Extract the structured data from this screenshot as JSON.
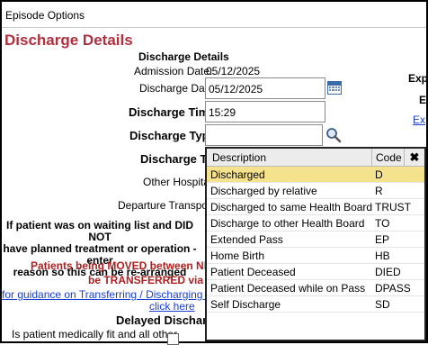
{
  "window": {
    "title": "Episode Options"
  },
  "page": {
    "title": "Discharge Details"
  },
  "form": {
    "section_title": "Discharge Details",
    "admission_label": "Admission Date:",
    "admission_value": "05/12/2025",
    "discharge_date_label": "Discharge Date",
    "discharge_date_value": "05/12/2025",
    "discharge_time_label": "Discharge Time",
    "discharge_time_value": "15:29",
    "discharge_type_label": "Discharge Type",
    "discharge_type_value": "",
    "discharge_to_label": "Discharge To",
    "other_hospital_label": "Other Hospital",
    "departure_transport_label": "Departure Transport",
    "waiting_list_line1": "If patient was on waiting list and DID NOT",
    "waiting_list_line2": "have planned treatment or operation - enter",
    "waiting_list_line3": "reason so this can be re-arranged",
    "moved_warning_line1": "Patients being MOVED between NHS Lo",
    "moved_warning_line2": "be TRANSFERRED via Mov",
    "guidance_link": "for guidance on Transferring / Discharging / On l",
    "click_here_link": "click here",
    "delayed_title": "Delayed Discharge",
    "medically_fit_label": "Is patient medically fit and all other"
  },
  "right_edge": {
    "exp_label": "Exp",
    "e_label": "E",
    "ex_link": "Ex"
  },
  "dropdown": {
    "col_description": "Description",
    "col_code": "Code",
    "close_symbol": "✖",
    "rows": [
      {
        "description": "Discharged",
        "code": "D"
      },
      {
        "description": "Discharged by relative",
        "code": "R"
      },
      {
        "description": "Discharged to same Health Board",
        "code": "TRUST"
      },
      {
        "description": "Discharge to other Health Board",
        "code": "TO"
      },
      {
        "description": "Extended Pass",
        "code": "EP"
      },
      {
        "description": "Home Birth",
        "code": "HB"
      },
      {
        "description": "Patient Deceased",
        "code": "DIED"
      },
      {
        "description": "Patient Deceased while on Pass",
        "code": "DPASS"
      },
      {
        "description": "Self Discharge",
        "code": "SD"
      }
    ],
    "selected_index": 0
  },
  "colors": {
    "title": "#b03040",
    "warning": "#b02020",
    "link": "#1a3fd0",
    "selected_row": "#f5e28c"
  }
}
